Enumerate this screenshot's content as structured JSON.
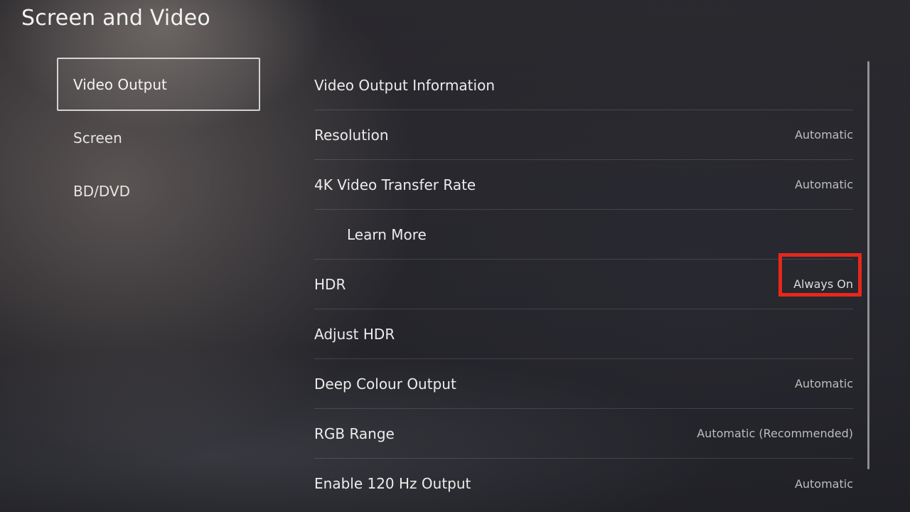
{
  "page": {
    "title": "Screen and Video"
  },
  "sidebar": {
    "items": [
      {
        "label": "Video Output",
        "selected": true
      },
      {
        "label": "Screen",
        "selected": false
      },
      {
        "label": "BD/DVD",
        "selected": false
      }
    ]
  },
  "settings": {
    "rows": [
      {
        "label": "Video Output Information",
        "value": ""
      },
      {
        "label": "Resolution",
        "value": "Automatic"
      },
      {
        "label": "4K Video Transfer Rate",
        "value": "Automatic"
      },
      {
        "label": "Learn More",
        "value": "",
        "indented": true
      },
      {
        "label": "HDR",
        "value": "Always On",
        "highlighted": true
      },
      {
        "label": "Adjust HDR",
        "value": ""
      },
      {
        "label": "Deep Colour Output",
        "value": "Automatic"
      },
      {
        "label": "RGB Range",
        "value": "Automatic (Recommended)"
      },
      {
        "label": "Enable 120 Hz Output",
        "value": "Automatic"
      }
    ]
  },
  "colors": {
    "highlight_box": "#e8271b",
    "background": "#1f1d22",
    "text": "#ececec",
    "secondary_text": "#bdbdbd"
  }
}
